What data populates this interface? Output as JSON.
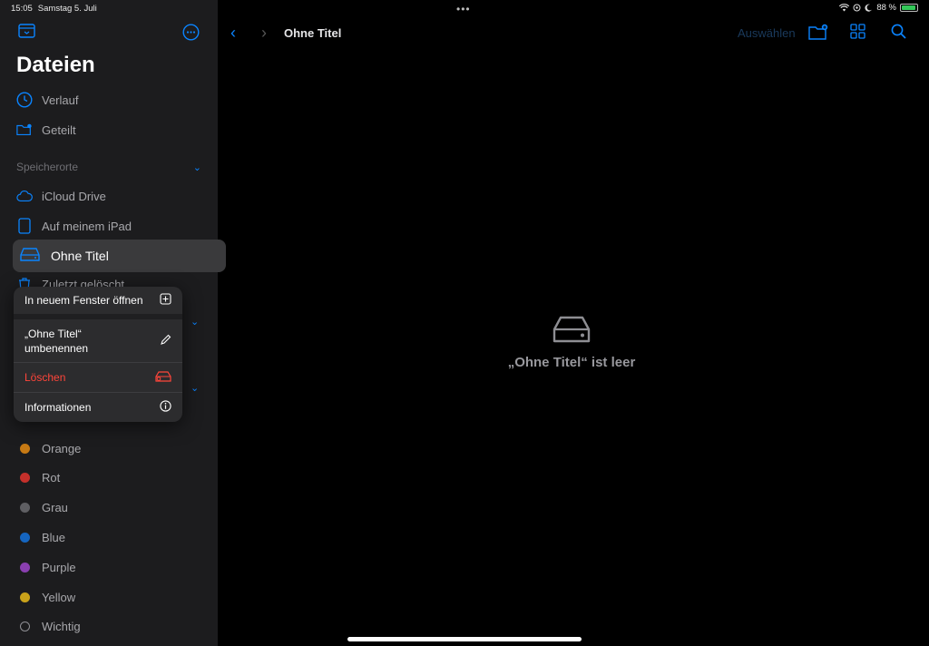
{
  "status": {
    "time": "15:05",
    "date": "Samstag 5. Juli",
    "battery": "88 %",
    "battery_level": 0.88
  },
  "sidebar": {
    "title": "Dateien",
    "recents": "Verlauf",
    "shared": "Geteilt",
    "locations_header": "Speicherorte",
    "icloud": "iCloud Drive",
    "on_ipad": "Auf meinem iPad",
    "selected": "Ohne Titel",
    "recently_deleted": "Zuletzt gelöscht",
    "tags": [
      {
        "label": "Orange",
        "color": "#c77a14"
      },
      {
        "label": "Rot",
        "color": "#c4302b"
      },
      {
        "label": "Grau",
        "color": "#5f5f63"
      },
      {
        "label": "Blue",
        "color": "#1565c0"
      },
      {
        "label": "Purple",
        "color": "#8a3fb0"
      },
      {
        "label": "Yellow",
        "color": "#c9a21a"
      },
      {
        "label": "Wichtig",
        "color": ""
      }
    ]
  },
  "context_menu": {
    "open_new_window": "In neuem Fenster öffnen",
    "rename_line1": "„Ohne Titel“",
    "rename_line2": "umbenennen",
    "delete": "Löschen",
    "info": "Informationen"
  },
  "toolbar": {
    "breadcrumb": "Ohne Titel",
    "select": "Auswählen"
  },
  "main": {
    "empty_message": "„Ohne Titel“ ist leer"
  },
  "colors": {
    "accent": "#0a84ff",
    "destructive": "#ff453a",
    "sidebar_bg": "#1c1c1e"
  }
}
